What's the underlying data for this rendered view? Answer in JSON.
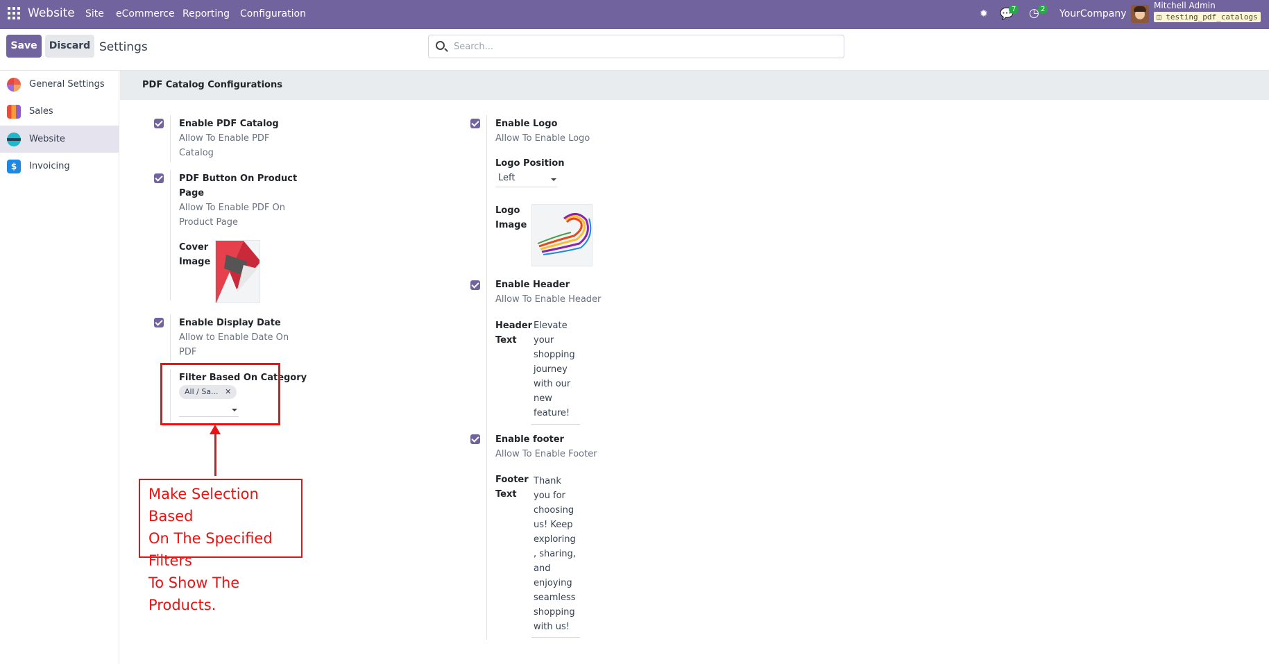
{
  "navbar": {
    "brand": "Website",
    "menu": [
      "Site",
      "eCommerce",
      "Reporting",
      "Configuration"
    ],
    "chat_count": "7",
    "activity_count": "2",
    "company": "YourCompany",
    "username": "Mitchell Admin",
    "database": "testing_pdf_catalogs"
  },
  "control_panel": {
    "save_label": "Save",
    "discard_label": "Discard",
    "title": "Settings",
    "search_placeholder": "Search..."
  },
  "sidebar": {
    "items": [
      {
        "label": "General Settings",
        "icon": "general-settings-icon"
      },
      {
        "label": "Sales",
        "icon": "sales-icon"
      },
      {
        "label": "Website",
        "icon": "website-icon",
        "active": true
      },
      {
        "label": "Invoicing",
        "icon": "invoicing-icon"
      }
    ]
  },
  "section": {
    "title": "PDF Catalog Configurations"
  },
  "left_settings": {
    "enable_pdf": {
      "label": "Enable PDF Catalog",
      "help_lines": [
        "Allow To Enable PDF",
        "Catalog"
      ],
      "checked": true
    },
    "pdf_button": {
      "label_lines": [
        "PDF Button On Product",
        "Page"
      ],
      "help_lines": [
        "Allow To Enable PDF On",
        "Product Page"
      ],
      "checked": true
    },
    "cover_image": {
      "label_lines": [
        "Cover",
        "Image"
      ]
    },
    "display_date": {
      "label": "Enable Display Date",
      "help_lines": [
        "Allow to Enable Date On",
        "PDF"
      ],
      "checked": true
    },
    "filter_category": {
      "label": "Filter Based On Category",
      "tag": "All / Sa..."
    }
  },
  "right_settings": {
    "enable_logo": {
      "label": "Enable Logo",
      "help": "Allow To Enable Logo",
      "checked": true
    },
    "logo_position": {
      "label": "Logo Position",
      "value": "Left"
    },
    "logo_image": {
      "label_lines": [
        "Logo",
        "Image"
      ]
    },
    "enable_header": {
      "label": "Enable Header",
      "help": "Allow To Enable Header",
      "checked": true
    },
    "header_text": {
      "label_lines": [
        "Header",
        "Text"
      ],
      "value_lines": [
        "Elevate",
        "your",
        "shopping",
        "journey",
        "with our",
        "new",
        "feature!"
      ]
    },
    "enable_footer": {
      "label": "Enable footer",
      "help": "Allow To Enable Footer",
      "checked": true
    },
    "footer_text": {
      "label_lines": [
        "Footer",
        "Text"
      ],
      "value_lines": [
        "Thank",
        "you for",
        "choosing",
        "us! Keep",
        "exploring",
        ", sharing,",
        "and",
        "enjoying",
        "seamless",
        "shopping",
        "with us!"
      ]
    }
  },
  "annotation": {
    "lines": [
      "Make Selection Based",
      "On The Specified Filters",
      "To Show The Products."
    ]
  },
  "colors": {
    "navbar": "#71639e",
    "annotation": "#ee1111"
  }
}
